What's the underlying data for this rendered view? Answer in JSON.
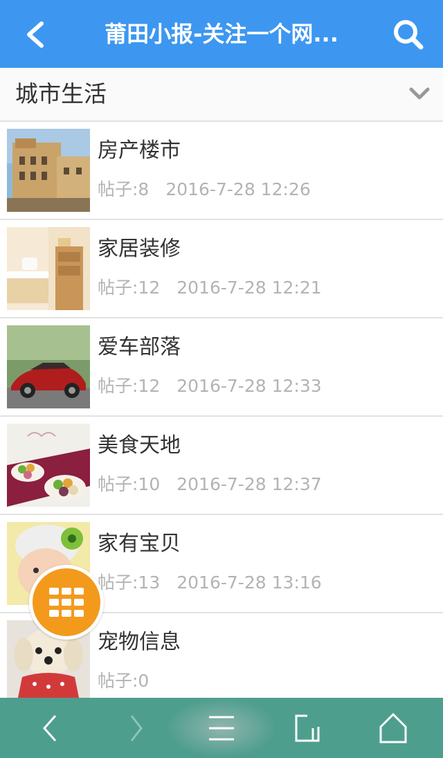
{
  "header": {
    "title": "莆田小报-关注一个网...",
    "back_icon": "chevron-left-icon",
    "search_icon": "search-icon",
    "background": "#3d97f0"
  },
  "category": {
    "label": "城市生活",
    "dropdown_icon": "chevron-down-icon"
  },
  "forums": [
    {
      "title": "房产楼市",
      "posts": "帖子:8",
      "date": "2016-7-28 12:26"
    },
    {
      "title": "家居装修",
      "posts": "帖子:12",
      "date": "2016-7-28 12:21"
    },
    {
      "title": "爱车部落",
      "posts": "帖子:12",
      "date": "2016-7-28 12:33"
    },
    {
      "title": "美食天地",
      "posts": "帖子:10",
      "date": "2016-7-28 12:37"
    },
    {
      "title": "家有宝贝",
      "posts": "帖子:13",
      "date": "2016-7-28 13:16"
    },
    {
      "title": "宠物信息",
      "posts": "帖子:0",
      "date": ""
    }
  ],
  "fab": {
    "icon": "grid-menu-icon",
    "color": "#f39a1d"
  },
  "bottom_nav": {
    "background": "#4e9e8e",
    "items": [
      "back-arrow-icon",
      "forward-arrow-icon",
      "menu-icon",
      "tabs-icon",
      "home-icon"
    ]
  }
}
